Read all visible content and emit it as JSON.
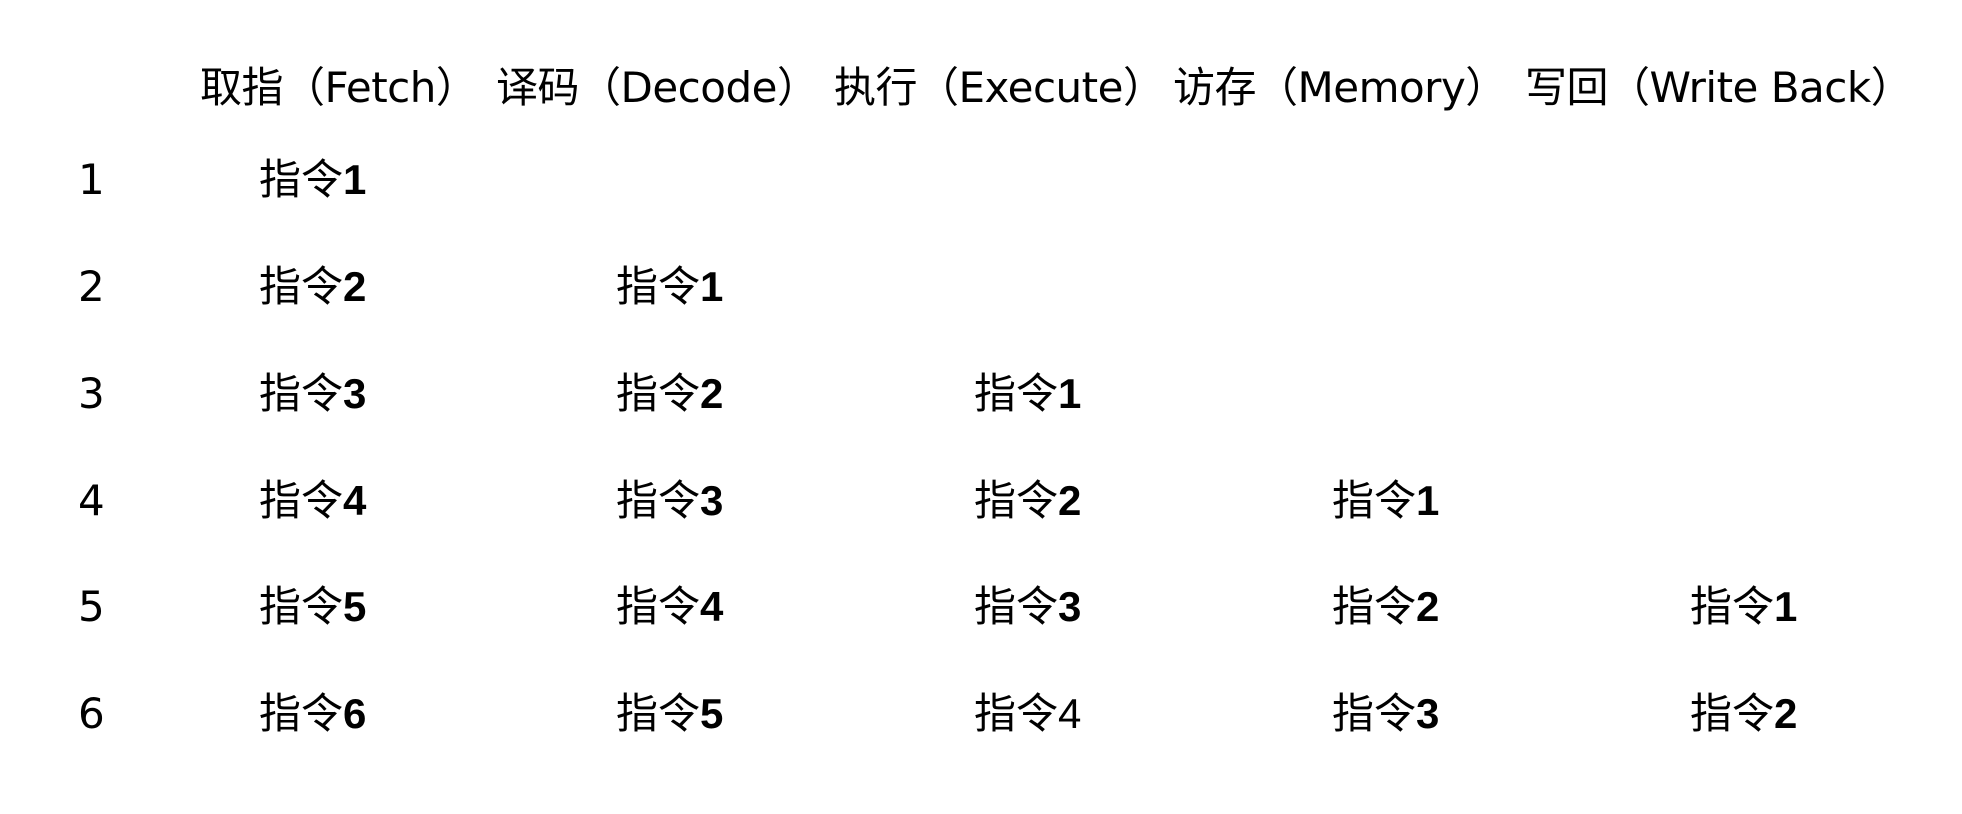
{
  "headers": [
    {
      "id": "fetch",
      "label": "取指（Fetch）"
    },
    {
      "id": "decode",
      "label": "译码（Decode）"
    },
    {
      "id": "execute",
      "label": "执行（Execute）"
    },
    {
      "id": "memory",
      "label": "访存（Memory）"
    },
    {
      "id": "writeback",
      "label": "写回（Write Back）"
    }
  ],
  "rows": [
    {
      "cycle": "1",
      "cells": [
        {
          "prefix": "指令",
          "num": "1",
          "bold": true
        },
        null,
        null,
        null,
        null
      ]
    },
    {
      "cycle": "2",
      "cells": [
        {
          "prefix": "指令",
          "num": "2",
          "bold": true
        },
        {
          "prefix": "指令",
          "num": "1",
          "bold": true
        },
        null,
        null,
        null
      ]
    },
    {
      "cycle": "3",
      "cells": [
        {
          "prefix": "指令",
          "num": "3",
          "bold": true
        },
        {
          "prefix": "指令",
          "num": "2",
          "bold": true
        },
        {
          "prefix": "指令",
          "num": "1",
          "bold": true
        },
        null,
        null
      ]
    },
    {
      "cycle": "4",
      "cells": [
        {
          "prefix": "指令",
          "num": "4",
          "bold": true
        },
        {
          "prefix": "指令",
          "num": "3",
          "bold": true
        },
        {
          "prefix": "指令",
          "num": "2",
          "bold": true
        },
        {
          "prefix": "指令",
          "num": "1",
          "bold": true
        },
        null
      ]
    },
    {
      "cycle": "5",
      "cells": [
        {
          "prefix": "指令",
          "num": "5",
          "bold": true
        },
        {
          "prefix": "指令",
          "num": "4",
          "bold": true
        },
        {
          "prefix": "指令",
          "num": "3",
          "bold": true
        },
        {
          "prefix": "指令",
          "num": "2",
          "bold": true
        },
        {
          "prefix": "指令",
          "num": "1",
          "bold": true
        }
      ]
    },
    {
      "cycle": "6",
      "cells": [
        {
          "prefix": "指令",
          "num": "6",
          "bold": true
        },
        {
          "prefix": "指令",
          "num": "5",
          "bold": true
        },
        {
          "prefix": "指令",
          "num": "4",
          "bold": false
        },
        {
          "prefix": "指令",
          "num": "3",
          "bold": true
        },
        {
          "prefix": "指令",
          "num": "2",
          "bold": true
        }
      ]
    }
  ]
}
